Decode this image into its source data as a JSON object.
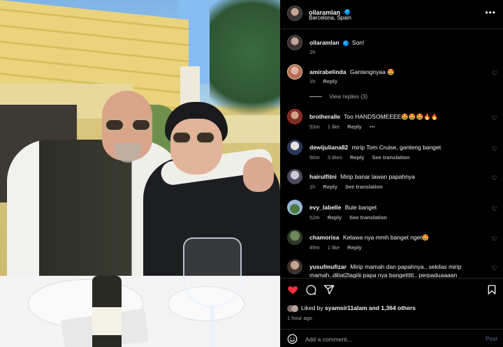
{
  "post": {
    "username": "ollaramlan",
    "location": "Barcelona, Spain",
    "caption": "Son!",
    "caption_time": "1h"
  },
  "comments": [
    {
      "user": "amirabelinda",
      "text": "Gantengnyaa 🤩",
      "time": "1h",
      "likes": "",
      "reply": "Reply",
      "translation": "",
      "view_replies": "View replies (3)"
    },
    {
      "user": "brotheralle",
      "text": "Too HANDSOMEEEE🤩🤩🤩🔥🔥",
      "time": "53m",
      "likes": "1 like",
      "reply": "Reply",
      "translation": "",
      "more": "•••"
    },
    {
      "user": "dewijuliana82",
      "text": "mirip Tom Cruise, ganteng banget",
      "time": "50m",
      "likes": "3 likes",
      "reply": "Reply",
      "translation": "See translation"
    },
    {
      "user": "hairulfitni",
      "text": "Mirip banar lawan papahnya",
      "time": "1h",
      "likes": "",
      "reply": "Reply",
      "translation": "See translation"
    },
    {
      "user": "evy_labelle",
      "text": "Bule banget",
      "time": "52m",
      "likes": "",
      "reply": "Reply",
      "translation": "See translation"
    },
    {
      "user": "chamorisa",
      "text": "Ketawa nya mmh banget nget🤩",
      "time": "49m",
      "likes": "1 like",
      "reply": "Reply",
      "translation": ""
    },
    {
      "user": "yusufmufizar",
      "text": "Mirip mamah dan papahnya.. sekilas mirip mamah..diliat2lagiiii papa nya bangettttt.. perpaduaaaan",
      "time": "",
      "likes": "",
      "reply": "",
      "translation": ""
    }
  ],
  "actions": {
    "liked_by_prefix": "Liked by",
    "liked_by_user": "syamsir11alam",
    "liked_by_suffix": "and 1,364 others",
    "post_time": "1 hour ago",
    "comment_placeholder": "Add a comment...",
    "post_label": "Post"
  },
  "icons": {
    "like": "heart-filled-icon",
    "comment": "comment-icon",
    "share": "share-icon",
    "save": "bookmark-icon",
    "emoji": "emoji-icon",
    "more": "more-horizontal-icon",
    "verified": "verified-badge-icon"
  },
  "colors": {
    "background": "#000000",
    "like_red": "#ff3040",
    "verified_blue": "#0095f6",
    "muted_text": "#a8a8a8"
  }
}
